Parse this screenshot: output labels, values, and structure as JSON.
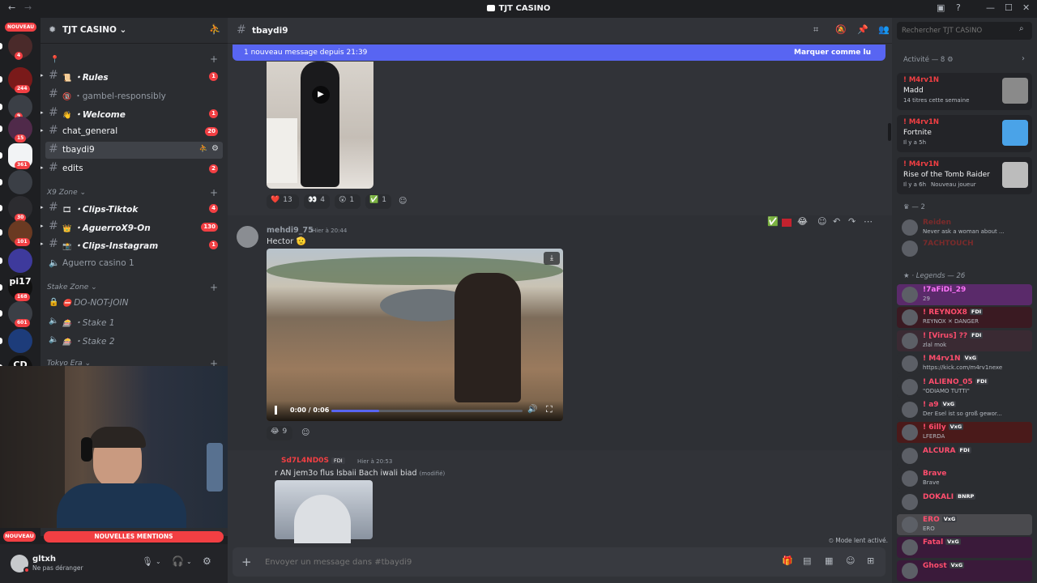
{
  "window": {
    "title": "TJT CASINO",
    "back": "←",
    "forward": "→"
  },
  "guilds": {
    "new_badge": "NOUVEAU",
    "items": [
      {
        "badge": "4"
      },
      {
        "badge": "244"
      },
      {
        "badge": "9"
      },
      {
        "badge": "15"
      },
      {
        "badge": "361"
      },
      {
        "badge": ""
      },
      {
        "badge": "30"
      },
      {
        "badge": "101"
      },
      {
        "badge": ""
      },
      {
        "badge": "168"
      },
      {
        "badge": "601"
      },
      {
        "badge": ""
      },
      {
        "badge": ""
      }
    ],
    "labels": {
      "pi7": "pi17",
      "cd": "CD"
    },
    "bottom_new": "NOUVEAU"
  },
  "server": {
    "name": "TJT CASINO ⌄"
  },
  "channels": {
    "top": [
      {
        "name": "・Rules",
        "emoji": "📜",
        "badge": "1"
      },
      {
        "name": "・gambel-responsibly",
        "emoji": "🔞",
        "badge": ""
      },
      {
        "name": "・Welcome",
        "emoji": "👋",
        "badge": "1"
      },
      {
        "name": "chat_general",
        "emoji": "",
        "badge": "20"
      },
      {
        "name": "tbaydi9",
        "emoji": "",
        "badge": ""
      },
      {
        "name": "edits",
        "emoji": "",
        "badge": "2"
      }
    ],
    "cat_x9": "X9 Zone ⌄",
    "x9": [
      {
        "name": "・Clips-Tiktok",
        "emoji": "🎞",
        "badge": "4"
      },
      {
        "name": "・AguerroX9-On",
        "emoji": "👑",
        "badge": "130"
      },
      {
        "name": "・Clips-Instagram",
        "emoji": "📸",
        "badge": "1"
      }
    ],
    "voice1": "Aguerro casino 1",
    "cat_stake": "Stake Zone ⌄",
    "stake": [
      {
        "name": "DO-NOT-JOIN",
        "emoji": "⛔"
      },
      {
        "name": "・Stake 1",
        "emoji": "🎰"
      },
      {
        "name": "・Stake 2",
        "emoji": "🎰"
      }
    ],
    "cat_tokyo": "Tokyo Era ⌄",
    "mentions": "NOUVELLES MENTIONS"
  },
  "user": {
    "name": "gltxh",
    "status": "Ne pas déranger"
  },
  "chat": {
    "channel": "tbaydi9",
    "new_banner": "1 nouveau message depuis 21:39",
    "mark_read": "Marquer comme lu",
    "reactions1": [
      {
        "emoji": "❤️",
        "count": "13"
      },
      {
        "emoji": "👀",
        "count": "4"
      },
      {
        "emoji": "😲",
        "count": "1"
      },
      {
        "emoji": "✅",
        "count": "1"
      }
    ],
    "msg1": {
      "author": "mehdi9_75",
      "time": "Hier à 20:44",
      "text": "Hector 🫡"
    },
    "video": {
      "time": "0:00 / 0:06",
      "progress": 0.25
    },
    "reactions2": [
      {
        "emoji": "😂",
        "count": "9"
      }
    ],
    "msg2": {
      "author": "Sd7L4ND0S",
      "tag": "FDI",
      "time": "Hier à 20:53",
      "text": "r AN jem3o flus lsbaii Bach iwali biad",
      "edited": "(modifié)"
    },
    "slowmode": "Mode lent activé.",
    "input_placeholder": "Envoyer un message dans #tbaydi9"
  },
  "members": {
    "activity_header": "Activité — 8",
    "activities": [
      {
        "name": "! M4rv1N",
        "game": "Madd",
        "sub": "14 titres cette semaine"
      },
      {
        "name": "! M4rv1N",
        "game": "Fortnite",
        "sub": "Il y a 5h"
      },
      {
        "name": "! M4rv1N",
        "game": "Rise of the Tomb Raider",
        "sub": "Il y a 6h",
        "sub2": "Nouveau joueur"
      }
    ],
    "group2": "— 2",
    "g2": [
      {
        "name": "Reiden",
        "sub": "Never ask a woman about ..."
      },
      {
        "name": "7ACHTOUCH",
        "sub": ""
      }
    ],
    "legends": "Legends — 26",
    "list": [
      {
        "name": "!7aFiDi_29",
        "tag": "",
        "sub": "29",
        "color": "#ff73fa"
      },
      {
        "name": "! REYNOX8",
        "tag": "FDI",
        "sub": "REYNOX ✕ DANGER",
        "color": "#ff4d6d"
      },
      {
        "name": "! [Virus] ??",
        "tag": "FDI",
        "sub": "zlal mok",
        "color": "#ff4d6d"
      },
      {
        "name": "! M4rv1N",
        "tag": "VxG",
        "sub": "https://kick.com/m4rv1nexe",
        "color": "#ff4d6d"
      },
      {
        "name": "! ALIENO_05",
        "tag": "FDI",
        "sub": "\"ODIAMO TUTTI\"",
        "color": "#ff4d6d"
      },
      {
        "name": "! a9",
        "tag": "VxG",
        "sub": "Der Esel ist so groß gewor...",
        "color": "#ff4d6d"
      },
      {
        "name": "! 6illy",
        "tag": "VxG",
        "sub": "LFERDA",
        "color": "#ff4d6d"
      },
      {
        "name": "ALCURA",
        "tag": "FDI",
        "sub": "",
        "color": "#ff4d6d"
      },
      {
        "name": "Brave",
        "tag": "",
        "sub": "Brave",
        "color": "#ff4d6d"
      },
      {
        "name": "DOKALI",
        "tag": "BNRP",
        "sub": "",
        "color": "#ff4d6d"
      },
      {
        "name": "ERO",
        "tag": "VxG",
        "sub": "ERO",
        "color": "#ff4d6d"
      },
      {
        "name": "Fatal",
        "tag": "VxG",
        "sub": "",
        "color": "#ff4d6d"
      },
      {
        "name": "Ghost",
        "tag": "VxG",
        "sub": "",
        "color": "#ff4d6d"
      }
    ],
    "search_placeholder": "Rechercher TJT CASINO"
  }
}
